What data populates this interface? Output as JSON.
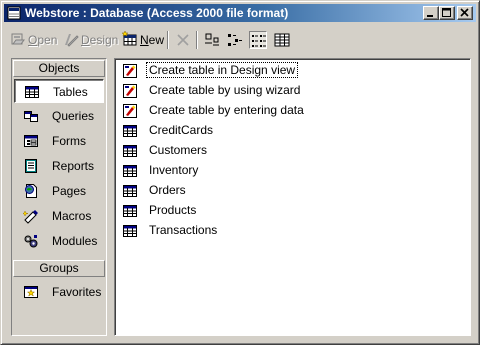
{
  "window": {
    "title": "Webstore : Database (Access 2000 file format)",
    "controls": {
      "minimize": "minimize",
      "maximize": "maximize",
      "close": "close"
    }
  },
  "toolbar": {
    "open": {
      "label": "Open",
      "mnemonic": "O",
      "rest": "pen",
      "enabled": false
    },
    "design": {
      "label": "Design",
      "mnemonic": "D",
      "rest": "esign",
      "enabled": false
    },
    "new": {
      "label": "New",
      "mnemonic": "N",
      "rest": "ew",
      "enabled": true
    },
    "view_modes": [
      "large-icons",
      "small-icons",
      "list",
      "details"
    ],
    "active_view": "list"
  },
  "objects_bar": {
    "objects_header": "Objects",
    "items": [
      {
        "label": "Tables",
        "icon": "table-icon",
        "selected": true
      },
      {
        "label": "Queries",
        "icon": "query-icon",
        "selected": false
      },
      {
        "label": "Forms",
        "icon": "form-icon",
        "selected": false
      },
      {
        "label": "Reports",
        "icon": "report-icon",
        "selected": false
      },
      {
        "label": "Pages",
        "icon": "page-icon",
        "selected": false
      },
      {
        "label": "Macros",
        "icon": "macro-icon",
        "selected": false
      },
      {
        "label": "Modules",
        "icon": "module-icon",
        "selected": false
      }
    ],
    "groups_header": "Groups",
    "groups": [
      {
        "label": "Favorites",
        "icon": "favorites-icon"
      }
    ]
  },
  "list": {
    "items": [
      {
        "label": "Create table in Design view",
        "icon": "wizard-shortcut-icon",
        "focused": true
      },
      {
        "label": "Create table by using wizard",
        "icon": "wizard-shortcut-icon",
        "focused": false
      },
      {
        "label": "Create table by entering data",
        "icon": "wizard-shortcut-icon",
        "focused": false
      },
      {
        "label": "CreditCards",
        "icon": "table-icon",
        "focused": false
      },
      {
        "label": "Customers",
        "icon": "table-icon",
        "focused": false
      },
      {
        "label": "Inventory",
        "icon": "table-icon",
        "focused": false
      },
      {
        "label": "Orders",
        "icon": "table-icon",
        "focused": false
      },
      {
        "label": "Products",
        "icon": "table-icon",
        "focused": false
      },
      {
        "label": "Transactions",
        "icon": "table-icon",
        "focused": false
      }
    ]
  },
  "colors": {
    "title_active_start": "#0a246a",
    "title_active_end": "#a6caf0",
    "face": "#d4d0c8",
    "window_bg": "#ffffff"
  }
}
